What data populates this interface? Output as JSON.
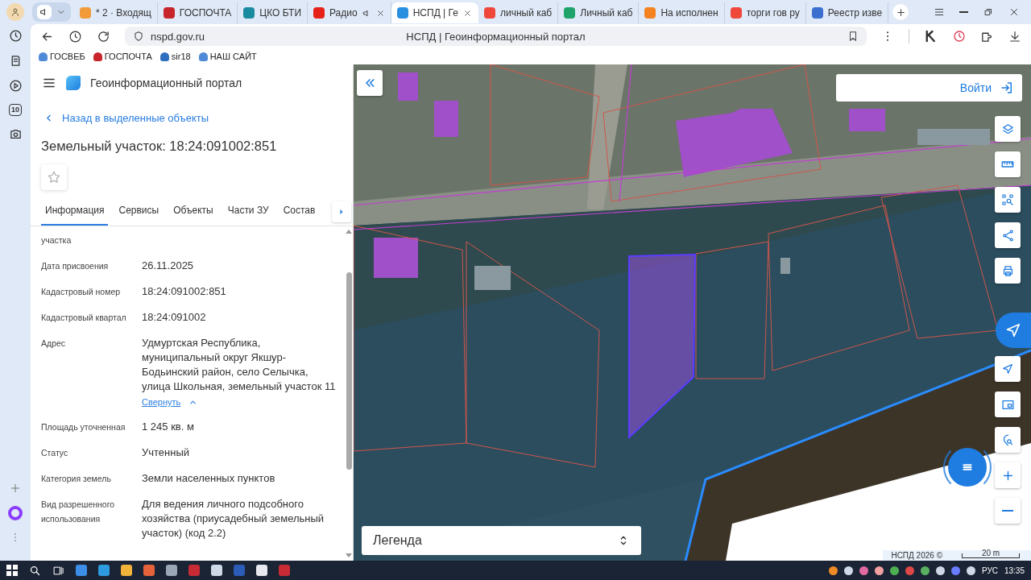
{
  "browser": {
    "tabs": [
      {
        "title": "* 2 · Входящ",
        "color": "#f29a38",
        "selected": false,
        "audio": false,
        "closable": false
      },
      {
        "title": "ГОСПОЧТА",
        "color": "#c8242b",
        "selected": false,
        "audio": false,
        "closable": false
      },
      {
        "title": "ЦКО БТИ",
        "color": "#1a8a9e",
        "selected": false,
        "audio": false,
        "closable": false
      },
      {
        "title": "Радио",
        "color": "#e62117",
        "selected": false,
        "audio": true,
        "closable": true
      },
      {
        "title": "НСПД | Ге",
        "color": "#2b8fe0",
        "selected": true,
        "audio": false,
        "closable": true
      },
      {
        "title": "личный каб",
        "color": "#f0473b",
        "selected": false,
        "audio": false,
        "closable": false
      },
      {
        "title": "Личный каб",
        "color": "#1fa36a",
        "selected": false,
        "audio": false,
        "closable": false
      },
      {
        "title": "На исполнен",
        "color": "#f58220",
        "selected": false,
        "audio": false,
        "closable": false
      },
      {
        "title": "торги гов ру",
        "color": "#f0473b",
        "selected": false,
        "audio": false,
        "closable": false
      },
      {
        "title": "Реестр изве",
        "color": "#3a6fd0",
        "selected": false,
        "audio": false,
        "closable": false
      }
    ],
    "url": "nspd.gov.ru",
    "page_title": "НСПД | Геоинформационный портал",
    "bookmarks": [
      {
        "label": "ГОСВЕБ",
        "color": "#4f8ad8"
      },
      {
        "label": "ГОСПОЧТА",
        "color": "#c8242b"
      },
      {
        "label": "sir18",
        "color": "#2f6fc0"
      },
      {
        "label": "НАШ САЙТ",
        "color": "#4f8ad8"
      }
    ],
    "sidebar_counter": "10"
  },
  "panel": {
    "app_title": "Геоинформационный портал",
    "back_link": "Назад в выделенные объекты",
    "title": "Земельный участок: 18:24:091002:851",
    "favorite": false,
    "tabs": [
      {
        "label": "Информация",
        "selected": true
      },
      {
        "label": "Сервисы",
        "selected": false
      },
      {
        "label": "Объекты",
        "selected": false
      },
      {
        "label": "Части ЗУ",
        "selected": false
      },
      {
        "label": "Состав",
        "selected": false
      }
    ],
    "fields": [
      {
        "label": "участка"
      },
      {
        "label": "Дата присвоения",
        "value": "26.11.2025"
      },
      {
        "label": "Кадастровый номер",
        "value": "18:24:091002:851"
      },
      {
        "label": "Кадастровый квартал",
        "value": "18:24:091002"
      },
      {
        "label": "Адрес",
        "value": "Удмуртская Республика, муниципальный округ Якшур-Бодьинский район, село Селычка, улица Школьная, земельный участок 11",
        "action": "Свернуть"
      },
      {
        "label": "Площадь уточненная",
        "value": "1 245 кв. м"
      },
      {
        "label": "Статус",
        "value": "Учтенный"
      },
      {
        "label": "Категория земель",
        "value": "Земли населенных пунктов"
      },
      {
        "label": "Вид разрешенного использования",
        "value": "Для ведения личного подсобного хозяйства (приусадебный земельный участок) (код 2.2)"
      }
    ]
  },
  "map": {
    "login": "Войти",
    "legend": "Легенда",
    "attribution": "НСПД 2026 ©",
    "scale": "20 m"
  },
  "taskbar": {
    "language": "РУС",
    "time": "13:35"
  }
}
